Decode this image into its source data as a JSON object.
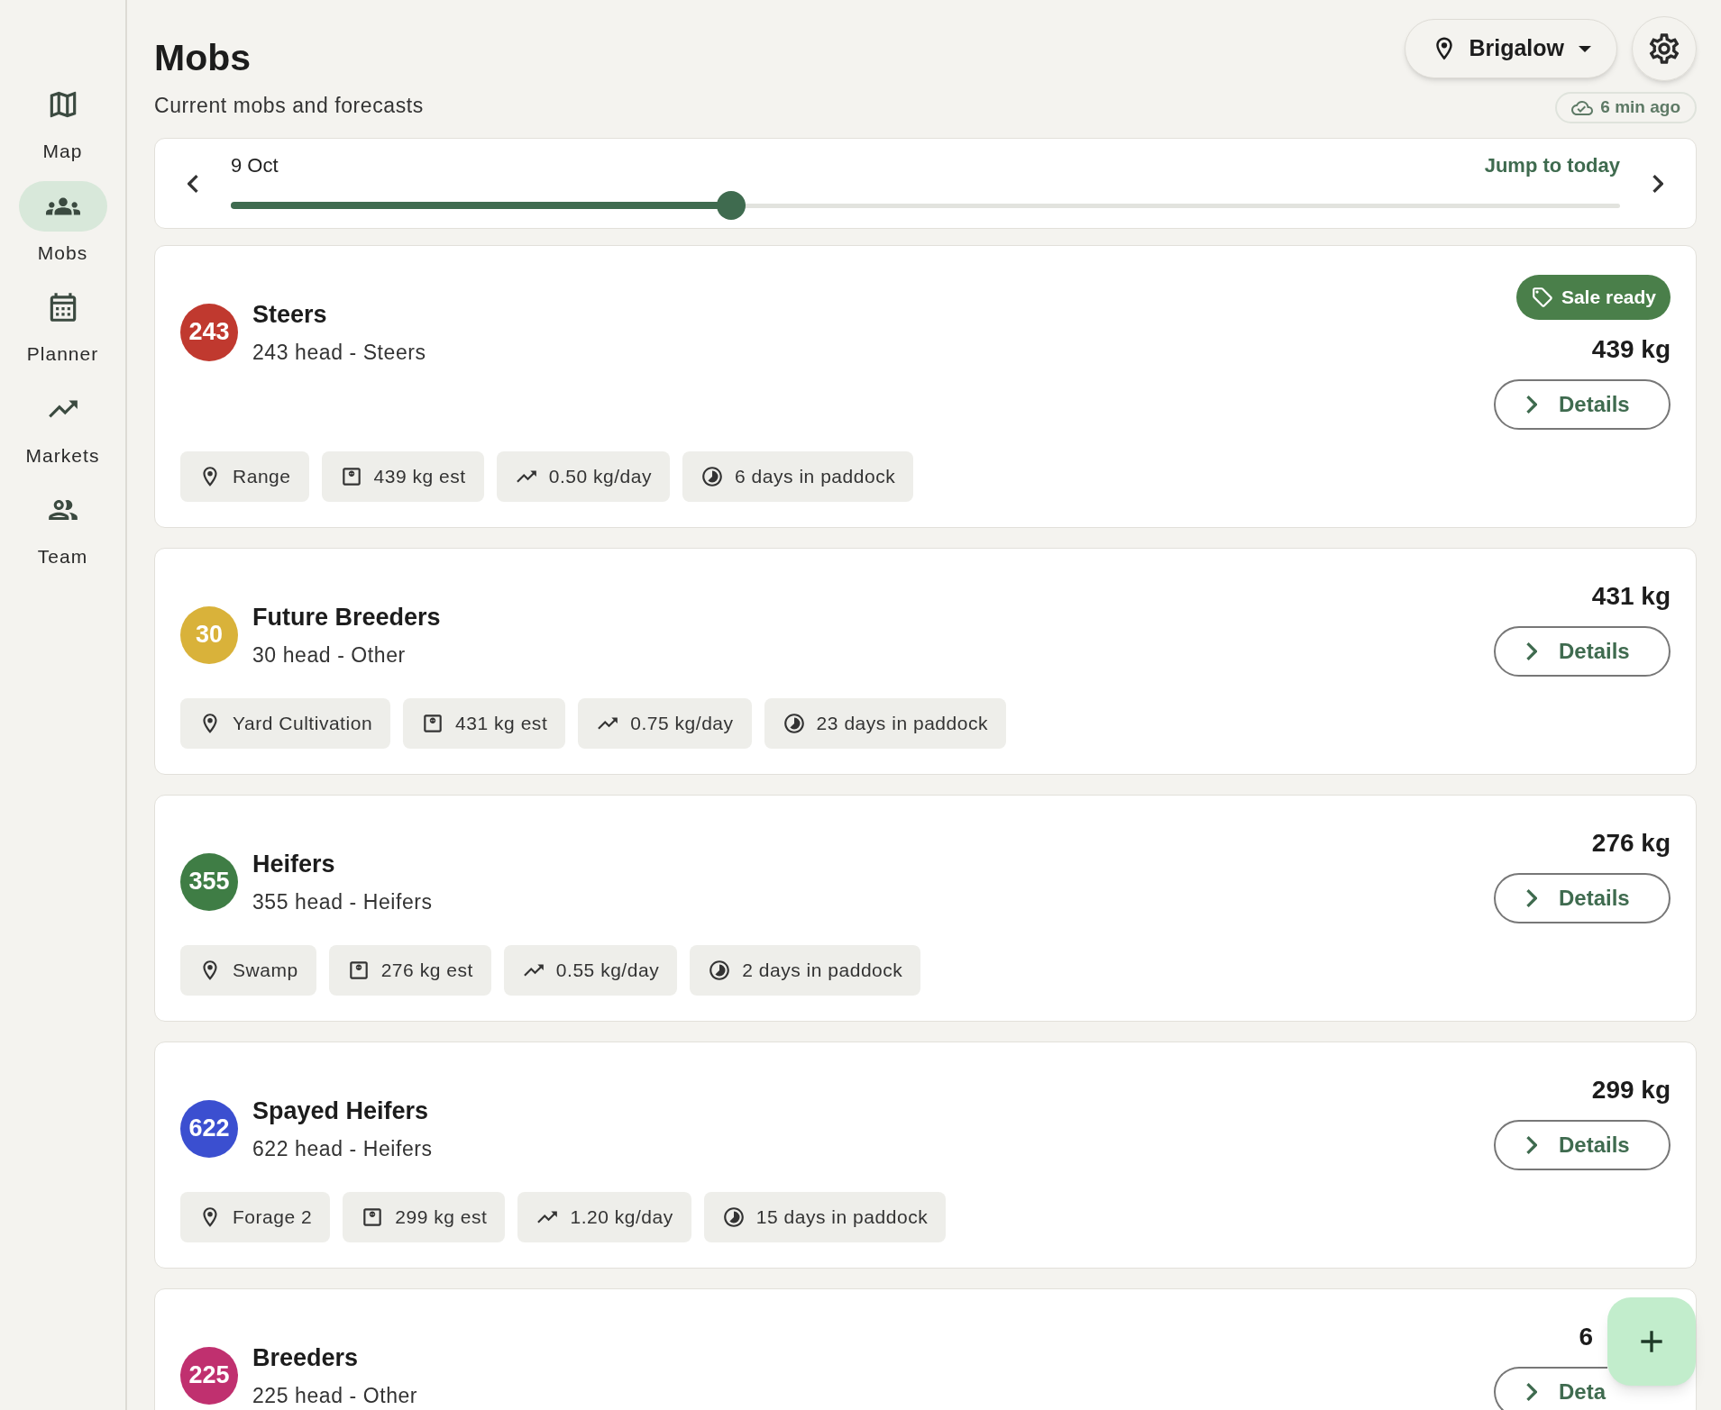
{
  "sidebar": {
    "items": [
      {
        "kind": "map",
        "label": "Map",
        "selected": false
      },
      {
        "kind": "mobs",
        "label": "Mobs",
        "selected": true
      },
      {
        "kind": "planner",
        "label": "Planner",
        "selected": false
      },
      {
        "kind": "markets",
        "label": "Markets",
        "selected": false
      },
      {
        "kind": "team",
        "label": "Team",
        "selected": false
      }
    ]
  },
  "header": {
    "title": "Mobs",
    "subtitle": "Current mobs and forecasts",
    "location": "Brigalow",
    "sync": "6 min ago"
  },
  "timeline": {
    "date": "9 Oct",
    "jump": "Jump to today",
    "level": 0.36
  },
  "mobs": [
    {
      "count": "243",
      "color": "#c0392f",
      "name": "Steers",
      "summary": "243 head - Steers",
      "sale_ready": "Sale ready",
      "weight": "439 kg",
      "details": "Details",
      "chips": [
        {
          "kind": "paddock",
          "text": "Range"
        },
        {
          "kind": "weight",
          "text": "439 kg est"
        },
        {
          "kind": "gain",
          "text": "0.50 kg/day"
        },
        {
          "kind": "days",
          "text": "6 days in paddock"
        }
      ]
    },
    {
      "count": "30",
      "color": "#d9b23a",
      "name": "Future Breeders",
      "summary": "30 head - Other",
      "weight": "431 kg",
      "details": "Details",
      "chips": [
        {
          "kind": "paddock",
          "text": "Yard Cultivation"
        },
        {
          "kind": "weight",
          "text": "431 kg est"
        },
        {
          "kind": "gain",
          "text": "0.75 kg/day"
        },
        {
          "kind": "days",
          "text": "23 days in paddock"
        }
      ]
    },
    {
      "count": "355",
      "color": "#3f7d45",
      "name": "Heifers",
      "summary": "355 head - Heifers",
      "weight": "276 kg",
      "details": "Details",
      "chips": [
        {
          "kind": "paddock",
          "text": "Swamp"
        },
        {
          "kind": "weight",
          "text": "276 kg est"
        },
        {
          "kind": "gain",
          "text": "0.55 kg/day"
        },
        {
          "kind": "days",
          "text": "2 days in paddock"
        }
      ]
    },
    {
      "count": "622",
      "color": "#3b4fd0",
      "name": "Spayed Heifers",
      "summary": "622 head - Heifers",
      "weight": "299 kg",
      "details": "Details",
      "chips": [
        {
          "kind": "paddock",
          "text": "Forage 2"
        },
        {
          "kind": "weight",
          "text": "299 kg est"
        },
        {
          "kind": "gain",
          "text": "1.20 kg/day"
        },
        {
          "kind": "days",
          "text": "15 days in paddock"
        }
      ]
    },
    {
      "count": "225",
      "color": "#c0306f",
      "name": "Breeders",
      "summary": "225 head - Other",
      "weight": "6",
      "details": "Deta"
    }
  ]
}
